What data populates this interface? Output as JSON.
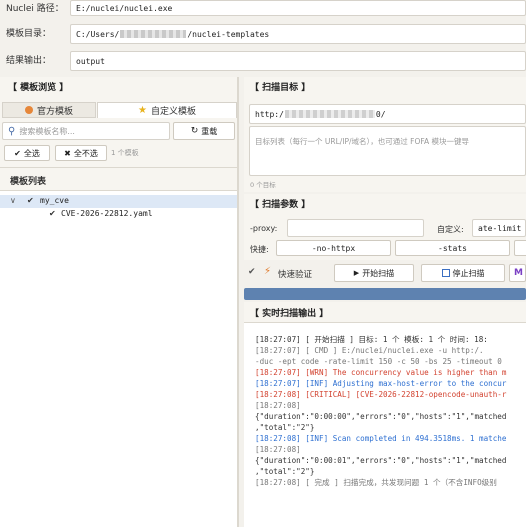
{
  "config": {
    "nuclei_path_label": "Nuclei 路径：",
    "nuclei_path_value": "E:/nuclei/nuclei.exe",
    "template_dir_label": "模板目录：",
    "template_dir_prefix": "C:/Users/",
    "template_dir_suffix": "/nuclei-templates",
    "output_label": "结果输出：",
    "output_value": "output"
  },
  "left": {
    "title": "【 模板浏览 】",
    "tabs": [
      {
        "label": "官方模板",
        "icon": "globe-icon"
      },
      {
        "label": "自定义模板",
        "icon": "star-icon"
      }
    ],
    "search_placeholder": "搜索模板名称...",
    "reload_label": "重载",
    "select_all_label": "全选",
    "deselect_all_label": "全不选",
    "count_label": "1 个模板",
    "list_header": "模板列表",
    "tree": {
      "folder": "my_cve",
      "file": "CVE-2026-22812.yaml"
    }
  },
  "right": {
    "target_title": "【 扫描目标 】",
    "target_url_prefix": "http:/",
    "target_url_suffix": "0/",
    "target_placeholder": "目标列表（每行一个 URL/IP/域名），也可通过 FOFA 模块一键导",
    "target_count": "0 个目标",
    "params_title": "【 扫描参数 】",
    "proxy_label": "-proxy:",
    "custom_label": "自定义:",
    "custom_value": "ate-limit",
    "quick_label": "快捷:",
    "quick_buttons": [
      "-no-httpx",
      "-stats"
    ],
    "actions": {
      "verify": "快速验证",
      "start": "开始扫描",
      "stop": "停止扫描"
    },
    "output_title": "【 实时扫描输出 】",
    "log_lines": [
      {
        "cls": "c-dark",
        "text": "[18:27:07] [ 开始扫描 ] 目标: 1 个  模板: 1 个  时间: 18:"
      },
      {
        "cls": "",
        "text": "[18:27:07] [ CMD ] E:/nuclei/nuclei.exe -u http:/."
      },
      {
        "cls": "",
        "text": "-duc -ept code -rate-limit 150 -c 50 -bs 25 -timeout 0"
      },
      {
        "cls": "c-warn",
        "text": "[18:27:07] [WRN] The concurrency value is higher than m"
      },
      {
        "cls": "c-inf",
        "text": "[18:27:07] [INF] Adjusting max-host-error to the concur"
      },
      {
        "cls": "c-crit",
        "text": "[18:27:08] [CRITICAL] [CVE-2026-22812-opencode-unauth-r"
      },
      {
        "cls": "",
        "text": "[18:27:08]"
      },
      {
        "cls": "c-dark",
        "text": "{\"duration\":\"0:00:00\",\"errors\":\"0\",\"hosts\":\"1\",\"matched"
      },
      {
        "cls": "c-dark",
        "text": ",\"total\":\"2\"}"
      },
      {
        "cls": "c-inf",
        "text": "[18:27:08] [INF] Scan completed in 494.3518ms. 1 matche"
      },
      {
        "cls": "",
        "text": "[18:27:08]"
      },
      {
        "cls": "c-dark",
        "text": "{\"duration\":\"0:00:01\",\"errors\":\"0\",\"hosts\":\"1\",\"matched"
      },
      {
        "cls": "c-dark",
        "text": ",\"total\":\"2\"}"
      },
      {
        "cls": "",
        "text": "[18:27:08] [ 完成 ] 扫描完成，共发现问题 1 个（不含INFO级别"
      }
    ]
  }
}
